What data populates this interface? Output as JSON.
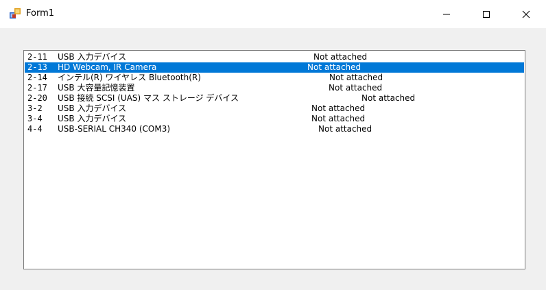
{
  "window": {
    "title": "Form1"
  },
  "titlebar_controls": {
    "minimize_icon": "minimize-icon",
    "maximize_icon": "maximize-icon",
    "close_icon": "close-icon"
  },
  "device_list": {
    "selected_index": 1,
    "items": [
      {
        "id": "2-11",
        "name": "USB 入力デバイス",
        "status": "Not attached"
      },
      {
        "id": "2-13",
        "name": "HD Webcam, IR Camera",
        "status": "Not attached"
      },
      {
        "id": "2-14",
        "name": "インテル(R) ワイヤレス Bluetooth(R)",
        "status": "Not attached"
      },
      {
        "id": "2-17",
        "name": "USB 大容量記憶装置",
        "status": "Not attached"
      },
      {
        "id": "2-20",
        "name": "USB 接続 SCSI (UAS) マス ストレージ デバイス",
        "status": "Not attached"
      },
      {
        "id": "3-2",
        "name": "USB 入力デバイス",
        "status": "Not attached"
      },
      {
        "id": "3-4",
        "name": "USB 入力デバイス",
        "status": "Not attached"
      },
      {
        "id": "4-4",
        "name": "USB-SERIAL CH340 (COM3)",
        "status": "Not attached"
      }
    ]
  },
  "colors": {
    "selection": "#0078d7",
    "background": "#f0f0f0"
  }
}
